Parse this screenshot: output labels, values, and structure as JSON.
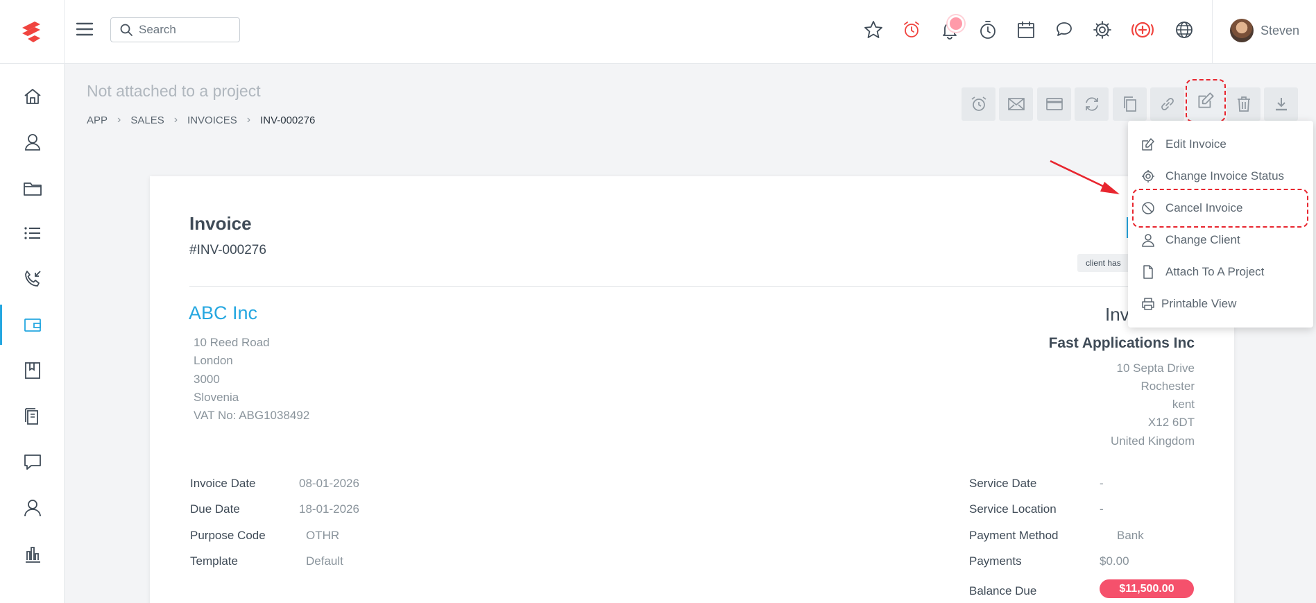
{
  "search": {
    "placeholder": "Search"
  },
  "user": {
    "name": "Steven"
  },
  "header": {
    "project_title": "Not attached to a project",
    "breadcrumb": [
      "APP",
      "SALES",
      "INVOICES",
      "INV-000276"
    ]
  },
  "invoice": {
    "title": "Invoice",
    "number": "#INV-000276",
    "status_chip": "client has",
    "right_label": "Inv",
    "client": {
      "name": "ABC Inc",
      "address": [
        "10 Reed Road",
        "London",
        "3000",
        "Slovenia",
        "VAT No: ABG1038492"
      ]
    },
    "company": {
      "name": "Fast Applications Inc",
      "address": [
        "10 Septa Drive",
        "Rochester",
        "kent",
        "X12 6DT",
        "United Kingdom"
      ]
    },
    "left_fields": [
      {
        "label": "Invoice Date",
        "value": "08-01-2026"
      },
      {
        "label": "Due Date",
        "value": "18-01-2026"
      },
      {
        "label": "Purpose Code",
        "value": "OTHR"
      },
      {
        "label": "Template",
        "value": "Default"
      }
    ],
    "right_fields": [
      {
        "label": "Service Date",
        "value": "-"
      },
      {
        "label": "Service Location",
        "value": "-"
      },
      {
        "label": "Payment Method",
        "value": "Bank"
      },
      {
        "label": "Payments",
        "value": "$0.00"
      },
      {
        "label": "Balance Due",
        "value": "$11,500.00"
      }
    ]
  },
  "menu": {
    "items": [
      {
        "label": "Edit Invoice",
        "icon": "edit-icon"
      },
      {
        "label": "Change Invoice Status",
        "icon": "gear-icon"
      },
      {
        "label": "Cancel Invoice",
        "icon": "ban-icon"
      },
      {
        "label": "Change Client",
        "icon": "user-icon"
      },
      {
        "label": "Attach To A Project",
        "icon": "file-icon"
      },
      {
        "label": "Printable View",
        "icon": "printer-icon"
      }
    ]
  },
  "colors": {
    "accent": "#25a7e0",
    "danger": "#e8262f",
    "balance": "#f5516c"
  }
}
